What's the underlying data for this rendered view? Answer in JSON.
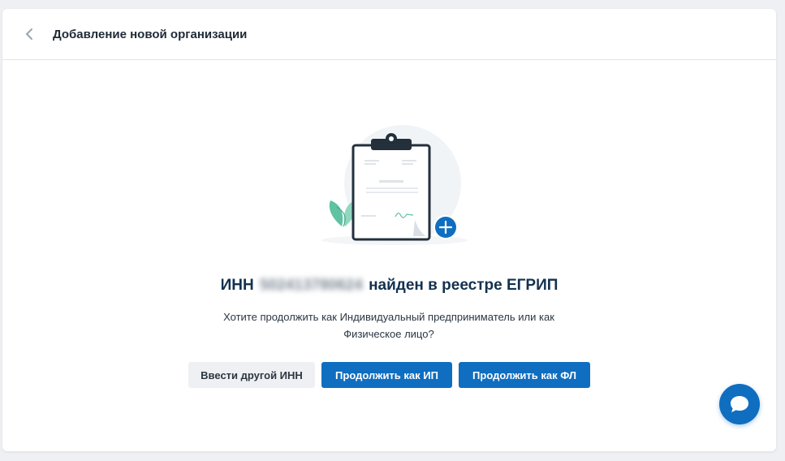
{
  "header": {
    "title": "Добавление новой организации"
  },
  "result": {
    "prefix": "ИНН",
    "inn_masked": "502413780624",
    "suffix": "найден в реестре ЕГРИП",
    "question_line1": "Хотите продолжить как Индивидуальный предприниматель или как",
    "question_line2": "Физическое лицо?"
  },
  "actions": {
    "other_inn": "Ввести другой ИНН",
    "continue_ip": "Продолжить как ИП",
    "continue_fl": "Продолжить как ФЛ"
  },
  "colors": {
    "accent": "#0f6ec0",
    "headline": "#13314f",
    "background": "#eef0f3"
  }
}
